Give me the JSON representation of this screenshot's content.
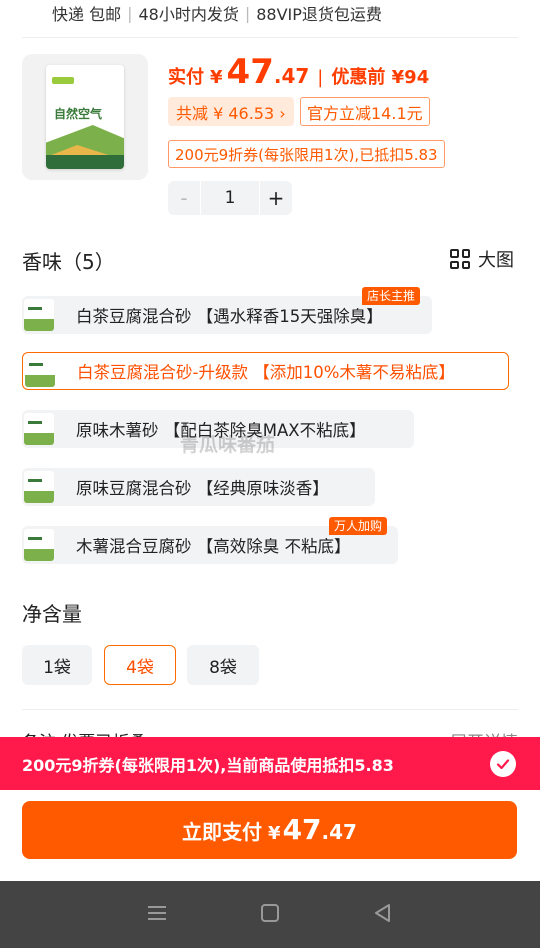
{
  "top_tags": [
    "快递 包邮",
    "48小时内发货",
    "88VIP退货包运费"
  ],
  "product": {
    "bag_name": "自然空气",
    "price_label": "实付",
    "currency": "¥",
    "price_int": "47",
    "price_dec": ".47",
    "orig_price": "优惠前 ¥94",
    "total_discount": "共减 ¥ 46.53 ›",
    "official_discount": "官方立减14.1元",
    "coupon_text": "200元9折券(每张限用1次),已抵扣5.83",
    "quantity": "1",
    "minus": "-",
    "plus": "+"
  },
  "scent_section": {
    "title": "香味（5）",
    "big_view_label": "大图",
    "options": [
      {
        "label": "白茶豆腐混合砂 【遇水释香15天强除臭】",
        "badge": "店长主推",
        "selected": false
      },
      {
        "label": "白茶豆腐混合砂-升级款 【添加10%木薯不易粘底】",
        "badge": "",
        "selected": true
      },
      {
        "label": "原味木薯砂 【配白茶除臭MAX不粘底】",
        "badge": "",
        "selected": false
      },
      {
        "label": "原味豆腐混合砂 【经典原味淡香】",
        "badge": "",
        "selected": false
      },
      {
        "label": "木薯混合豆腐砂 【高效除臭 不粘底】",
        "badge": "万人加购",
        "selected": false
      }
    ]
  },
  "watermark": "青瓜味番茄",
  "net_section": {
    "title": "净含量",
    "options": [
      {
        "label": "1袋",
        "selected": false
      },
      {
        "label": "4袋",
        "selected": true
      },
      {
        "label": "8袋",
        "selected": false
      }
    ]
  },
  "remark": {
    "left": "备注 发票已折叠",
    "right": "展开详情"
  },
  "coupon_bar": {
    "text": "200元9折券(每张限用1次),当前商品使用抵扣5.83"
  },
  "pay_button": {
    "label": "立即支付",
    "currency": "¥",
    "int": "47",
    "dec": ".47"
  },
  "nav": {
    "icons": [
      "menu-icon",
      "home-square-icon",
      "back-triangle-icon"
    ]
  },
  "colors": {
    "accent": "#ff5a00",
    "price": "#ff3d00",
    "coupon_bar": "#ff1a4b",
    "nav": "#444444"
  }
}
